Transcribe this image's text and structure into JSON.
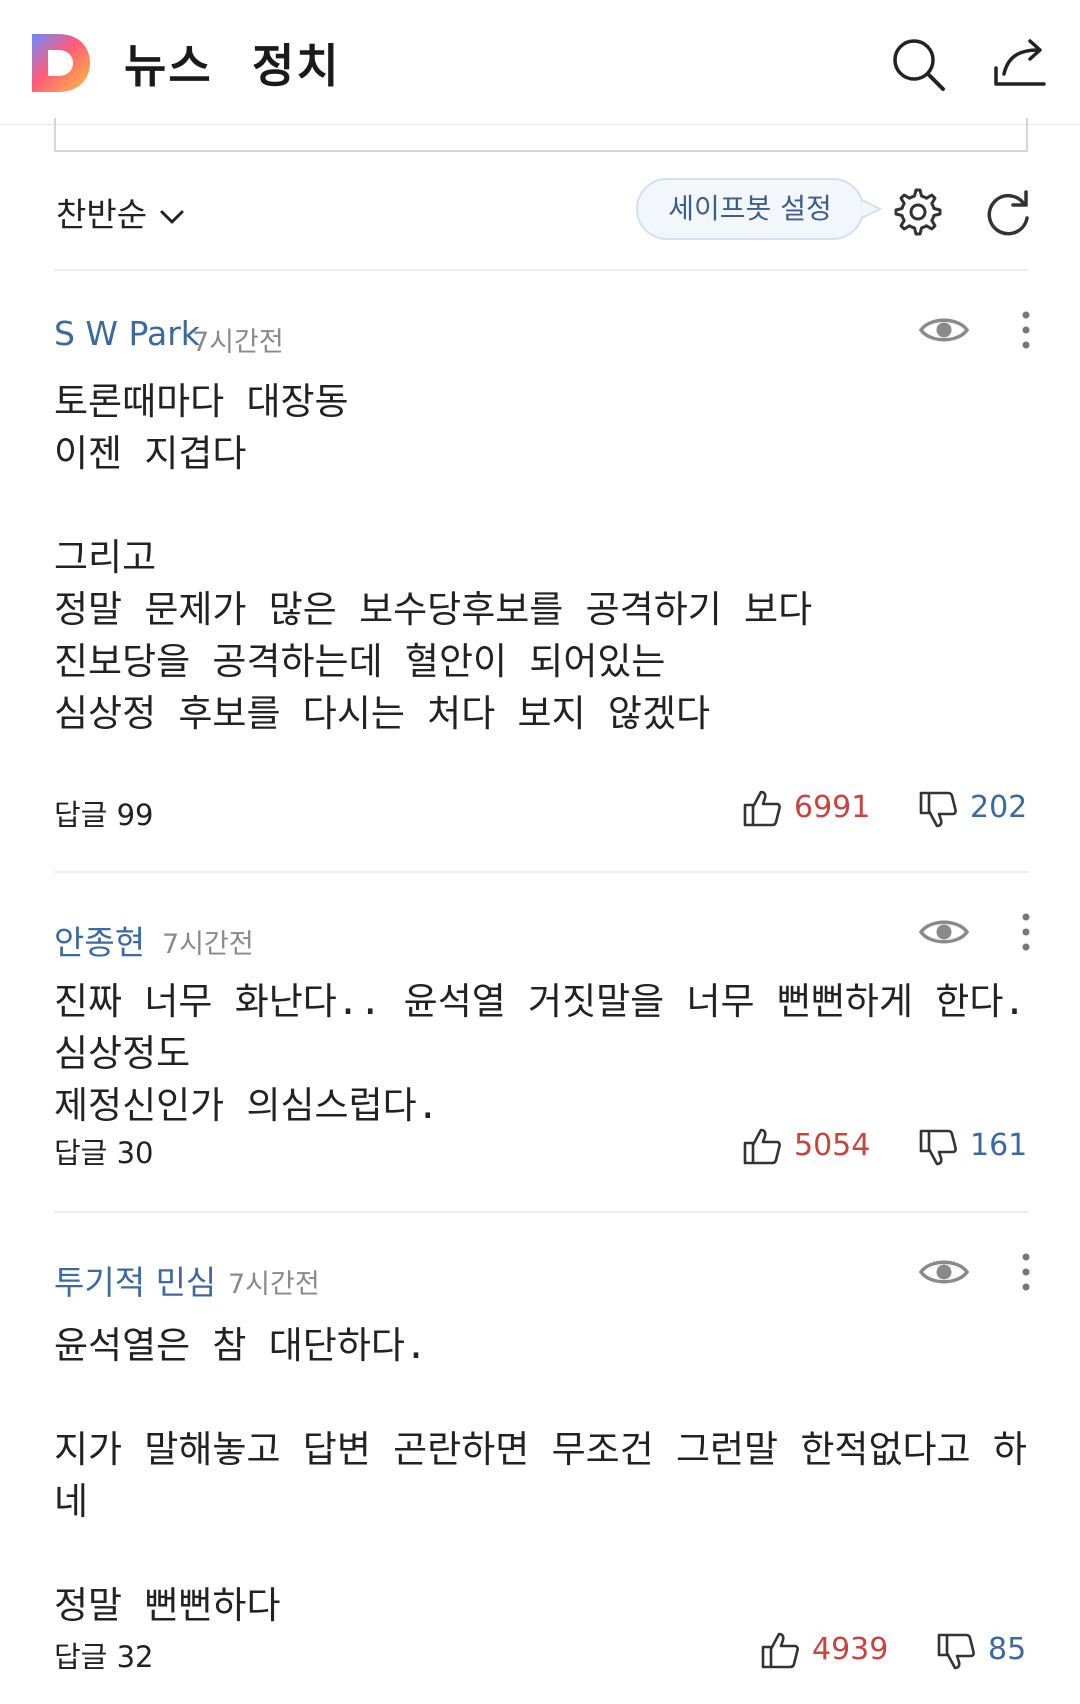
{
  "header": {
    "app_logo": "D",
    "title": "뉴스",
    "section": "정치",
    "icons": [
      "search-icon",
      "share-icon"
    ]
  },
  "toolbar": {
    "sort_label": "찬반순",
    "safebot_label": "세이프봇 설정",
    "icons": [
      "chevron-down-icon",
      "gear-icon",
      "refresh-icon"
    ]
  },
  "colors": {
    "author": "#3c6aa0",
    "like": "#c8443f",
    "dislike": "#3c6aa0"
  },
  "comments": [
    {
      "author": "S W Park",
      "time": "7시간전",
      "body": "토론때마다 대장동\n이젠 지겹다\n\n그리고\n정말 문제가 많은 보수당후보를 공격하기 보다\n진보당을 공격하는데 혈안이 되어있는\n심상정 후보를 다시는 처다 보지 않겠다",
      "replies": "답글 99",
      "likes": "6991",
      "dislikes": "202"
    },
    {
      "author": "안종현",
      "time": "7시간전",
      "body": "진짜 너무 화난다.. 윤석열 거짓말을 너무 뻔뻔하게 한다. 심상정도\n제정신인가 의심스럽다.",
      "replies": "답글 30",
      "likes": "5054",
      "dislikes": "161"
    },
    {
      "author": "투기적 민심",
      "time": "7시간전",
      "body": "윤석열은 참 대단하다.\n\n지가 말해놓고 답변 곤란하면 무조건 그런말 한적없다고 하네\n\n정말 뻔뻔하다",
      "replies": "답글 32",
      "likes": "4939",
      "dislikes": "85"
    }
  ]
}
